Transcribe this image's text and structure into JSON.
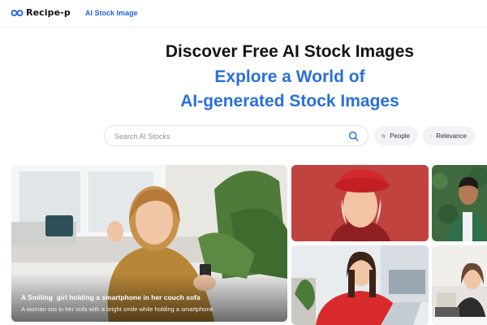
{
  "header": {
    "logo_text": "Recipe-p",
    "nav_link": "AI Stock Image"
  },
  "hero": {
    "title": "Discover Free AI Stock Images",
    "subtitle_line1": "Explore a World of",
    "subtitle_line2": "AI-generated Stock Images"
  },
  "search": {
    "placeholder": "Search AI Stocks",
    "value": ""
  },
  "filters": {
    "people_label": "People",
    "relevance_label": "Relevance"
  },
  "gallery": {
    "featured": {
      "title": "A Smiling  girl holding a smartphone in her couch sofa",
      "description": "A woman sits in her sofa with a bright smile while holding a smartphone"
    },
    "images": [
      {
        "subject": "older woman in red beret",
        "icon": "photo"
      },
      {
        "subject": "smiling man in green jacket",
        "icon": "photo"
      },
      {
        "subject": "woman in red sweater with laptop",
        "icon": "photo"
      },
      {
        "subject": "woman at desk with laptop",
        "icon": "photo"
      }
    ]
  },
  "colors": {
    "accent": "#2a6fdb",
    "link": "#2563d6",
    "pill_bg": "#f1f3f6"
  }
}
